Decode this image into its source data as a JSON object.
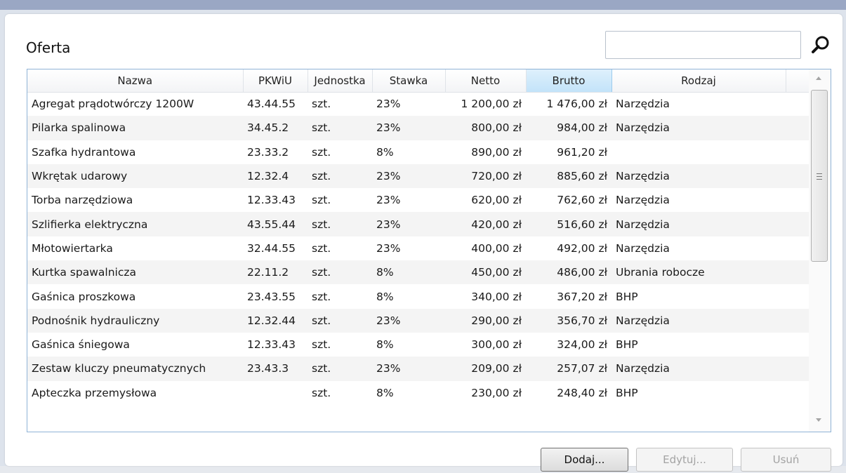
{
  "header": {
    "title": "Oferta",
    "search_placeholder": "",
    "search_value": ""
  },
  "table": {
    "columns": [
      {
        "key": "nazwa",
        "label": "Nazwa"
      },
      {
        "key": "pkwiu",
        "label": "PKWiU"
      },
      {
        "key": "jednostka",
        "label": "Jednostka"
      },
      {
        "key": "stawka",
        "label": "Stawka"
      },
      {
        "key": "netto",
        "label": "Netto"
      },
      {
        "key": "brutto",
        "label": "Brutto"
      },
      {
        "key": "rodzaj",
        "label": "Rodzaj"
      }
    ],
    "sorted_column": "brutto",
    "rows": [
      {
        "nazwa": "Agregat prądotwórczy 1200W",
        "pkwiu": "43.44.55",
        "jednostka": "szt.",
        "stawka": "23%",
        "netto": "1 200,00 zł",
        "brutto": "1 476,00 zł",
        "rodzaj": "Narzędzia"
      },
      {
        "nazwa": "Pilarka spalinowa",
        "pkwiu": "34.45.2",
        "jednostka": "szt.",
        "stawka": "23%",
        "netto": "800,00 zł",
        "brutto": "984,00 zł",
        "rodzaj": "Narzędzia"
      },
      {
        "nazwa": "Szafka hydrantowa",
        "pkwiu": "23.33.2",
        "jednostka": "szt.",
        "stawka": "8%",
        "netto": "890,00 zł",
        "brutto": "961,20 zł",
        "rodzaj": ""
      },
      {
        "nazwa": "Wkrętak udarowy",
        "pkwiu": "12.32.4",
        "jednostka": "szt.",
        "stawka": "23%",
        "netto": "720,00 zł",
        "brutto": "885,60 zł",
        "rodzaj": "Narzędzia"
      },
      {
        "nazwa": "Torba narzędziowa",
        "pkwiu": "12.33.43",
        "jednostka": "szt.",
        "stawka": "23%",
        "netto": "620,00 zł",
        "brutto": "762,60 zł",
        "rodzaj": "Narzędzia"
      },
      {
        "nazwa": "Szlifierka elektryczna",
        "pkwiu": "43.55.44",
        "jednostka": "szt.",
        "stawka": "23%",
        "netto": "420,00 zł",
        "brutto": "516,60 zł",
        "rodzaj": "Narzędzia"
      },
      {
        "nazwa": "Młotowiertarka",
        "pkwiu": "32.44.55",
        "jednostka": "szt.",
        "stawka": "23%",
        "netto": "400,00 zł",
        "brutto": "492,00 zł",
        "rodzaj": "Narzędzia"
      },
      {
        "nazwa": "Kurtka spawalnicza",
        "pkwiu": "22.11.2",
        "jednostka": "szt.",
        "stawka": "8%",
        "netto": "450,00 zł",
        "brutto": "486,00 zł",
        "rodzaj": "Ubrania robocze"
      },
      {
        "nazwa": "Gaśnica proszkowa",
        "pkwiu": "23.43.55",
        "jednostka": "szt.",
        "stawka": "8%",
        "netto": "340,00 zł",
        "brutto": "367,20 zł",
        "rodzaj": "BHP"
      },
      {
        "nazwa": "Podnośnik hydrauliczny",
        "pkwiu": "12.32.44",
        "jednostka": "szt.",
        "stawka": "23%",
        "netto": "290,00 zł",
        "brutto": "356,70 zł",
        "rodzaj": "Narzędzia"
      },
      {
        "nazwa": "Gaśnica śniegowa",
        "pkwiu": "12.33.43",
        "jednostka": "szt.",
        "stawka": "8%",
        "netto": "300,00 zł",
        "brutto": "324,00 zł",
        "rodzaj": "BHP"
      },
      {
        "nazwa": "Zestaw kluczy pneumatycznych",
        "pkwiu": "23.43.3",
        "jednostka": "szt.",
        "stawka": "23%",
        "netto": "209,00 zł",
        "brutto": "257,07 zł",
        "rodzaj": "Narzędzia"
      },
      {
        "nazwa": "Apteczka przemysłowa",
        "pkwiu": "",
        "jednostka": "szt.",
        "stawka": "8%",
        "netto": "230,00 zł",
        "brutto": "248,40 zł",
        "rodzaj": "BHP"
      }
    ]
  },
  "buttons": {
    "add": "Dodaj...",
    "edit": "Edytuj...",
    "delete": "Usuń"
  },
  "colors": {
    "sorted_header": "#c3e3f9",
    "grid_border": "#8fb3d6",
    "alt_row": "#f4f4f4"
  },
  "icons": {
    "search": "search-icon"
  }
}
